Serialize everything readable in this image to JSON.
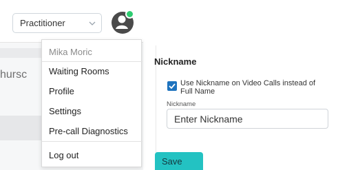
{
  "topbar": {
    "role_select": {
      "value": "Practitioner",
      "icon": "chevron-down-icon"
    },
    "avatar": {
      "icon": "account-avatar-icon",
      "status_color": "#2ecc71"
    }
  },
  "background": {
    "partial_text": "hursc"
  },
  "user_menu": {
    "username": "Mika Moric",
    "items": [
      "Waiting Rooms",
      "Profile",
      "Settings",
      "Pre-call Diagnostics"
    ],
    "logout_label": "Log out"
  },
  "nickname_settings": {
    "title": "Nickname",
    "checkbox_label": "Use Nickname on Video Calls instead of Full Name",
    "checkbox_checked": true,
    "field_label": "Nickname",
    "input_placeholder": "Enter Nickname",
    "input_value": "",
    "save_label": "Save"
  },
  "colors": {
    "accent": "#23c2c2",
    "checkbox": "#1e73be",
    "status_online": "#2ecc71"
  }
}
